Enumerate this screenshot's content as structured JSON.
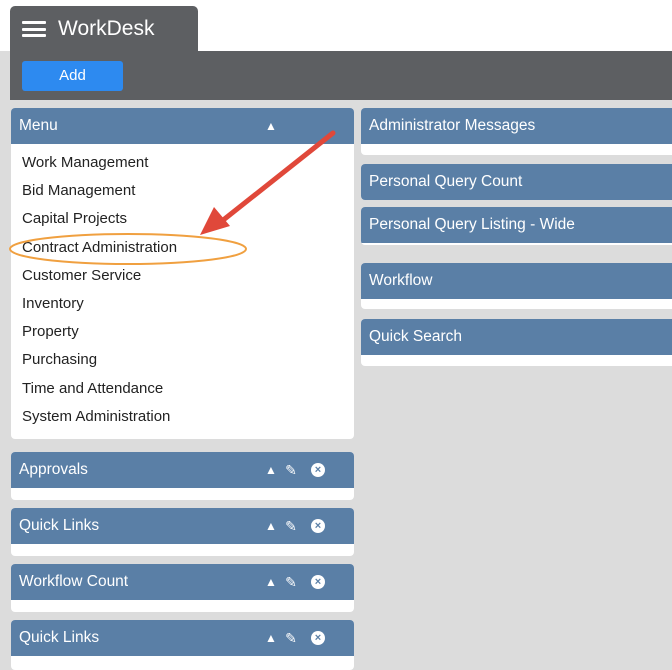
{
  "app": {
    "title": "WorkDesk"
  },
  "toolbar": {
    "add_label": "Add"
  },
  "menu": {
    "title": "Menu",
    "items": [
      "Work Management",
      "Bid Management",
      "Capital Projects",
      "Contract Administration",
      "Customer Service",
      "Inventory",
      "Property",
      "Purchasing",
      "Time and Attendance",
      "System Administration"
    ]
  },
  "left_widgets": [
    {
      "title": "Approvals"
    },
    {
      "title": "Quick Links"
    },
    {
      "title": "Workflow Count"
    },
    {
      "title": "Quick Links"
    }
  ],
  "right_widgets": [
    {
      "title": "Administrator Messages"
    },
    {
      "title": "Personal Query Count"
    },
    {
      "title": "Personal Query Listing - Wide"
    },
    {
      "title": "Workflow"
    },
    {
      "title": "Quick Search"
    }
  ],
  "colors": {
    "header_bar": "#5d5f62",
    "panel_header": "#5a7fa6",
    "add_button": "#2d8af0",
    "annotation_arrow": "#e0483a",
    "annotation_ellipse": "#f0a040"
  },
  "icons": {
    "hamburger": "hamburger-menu-icon",
    "collapse": "collapse-up-icon",
    "edit": "edit-icon",
    "close": "close-circle-icon"
  }
}
